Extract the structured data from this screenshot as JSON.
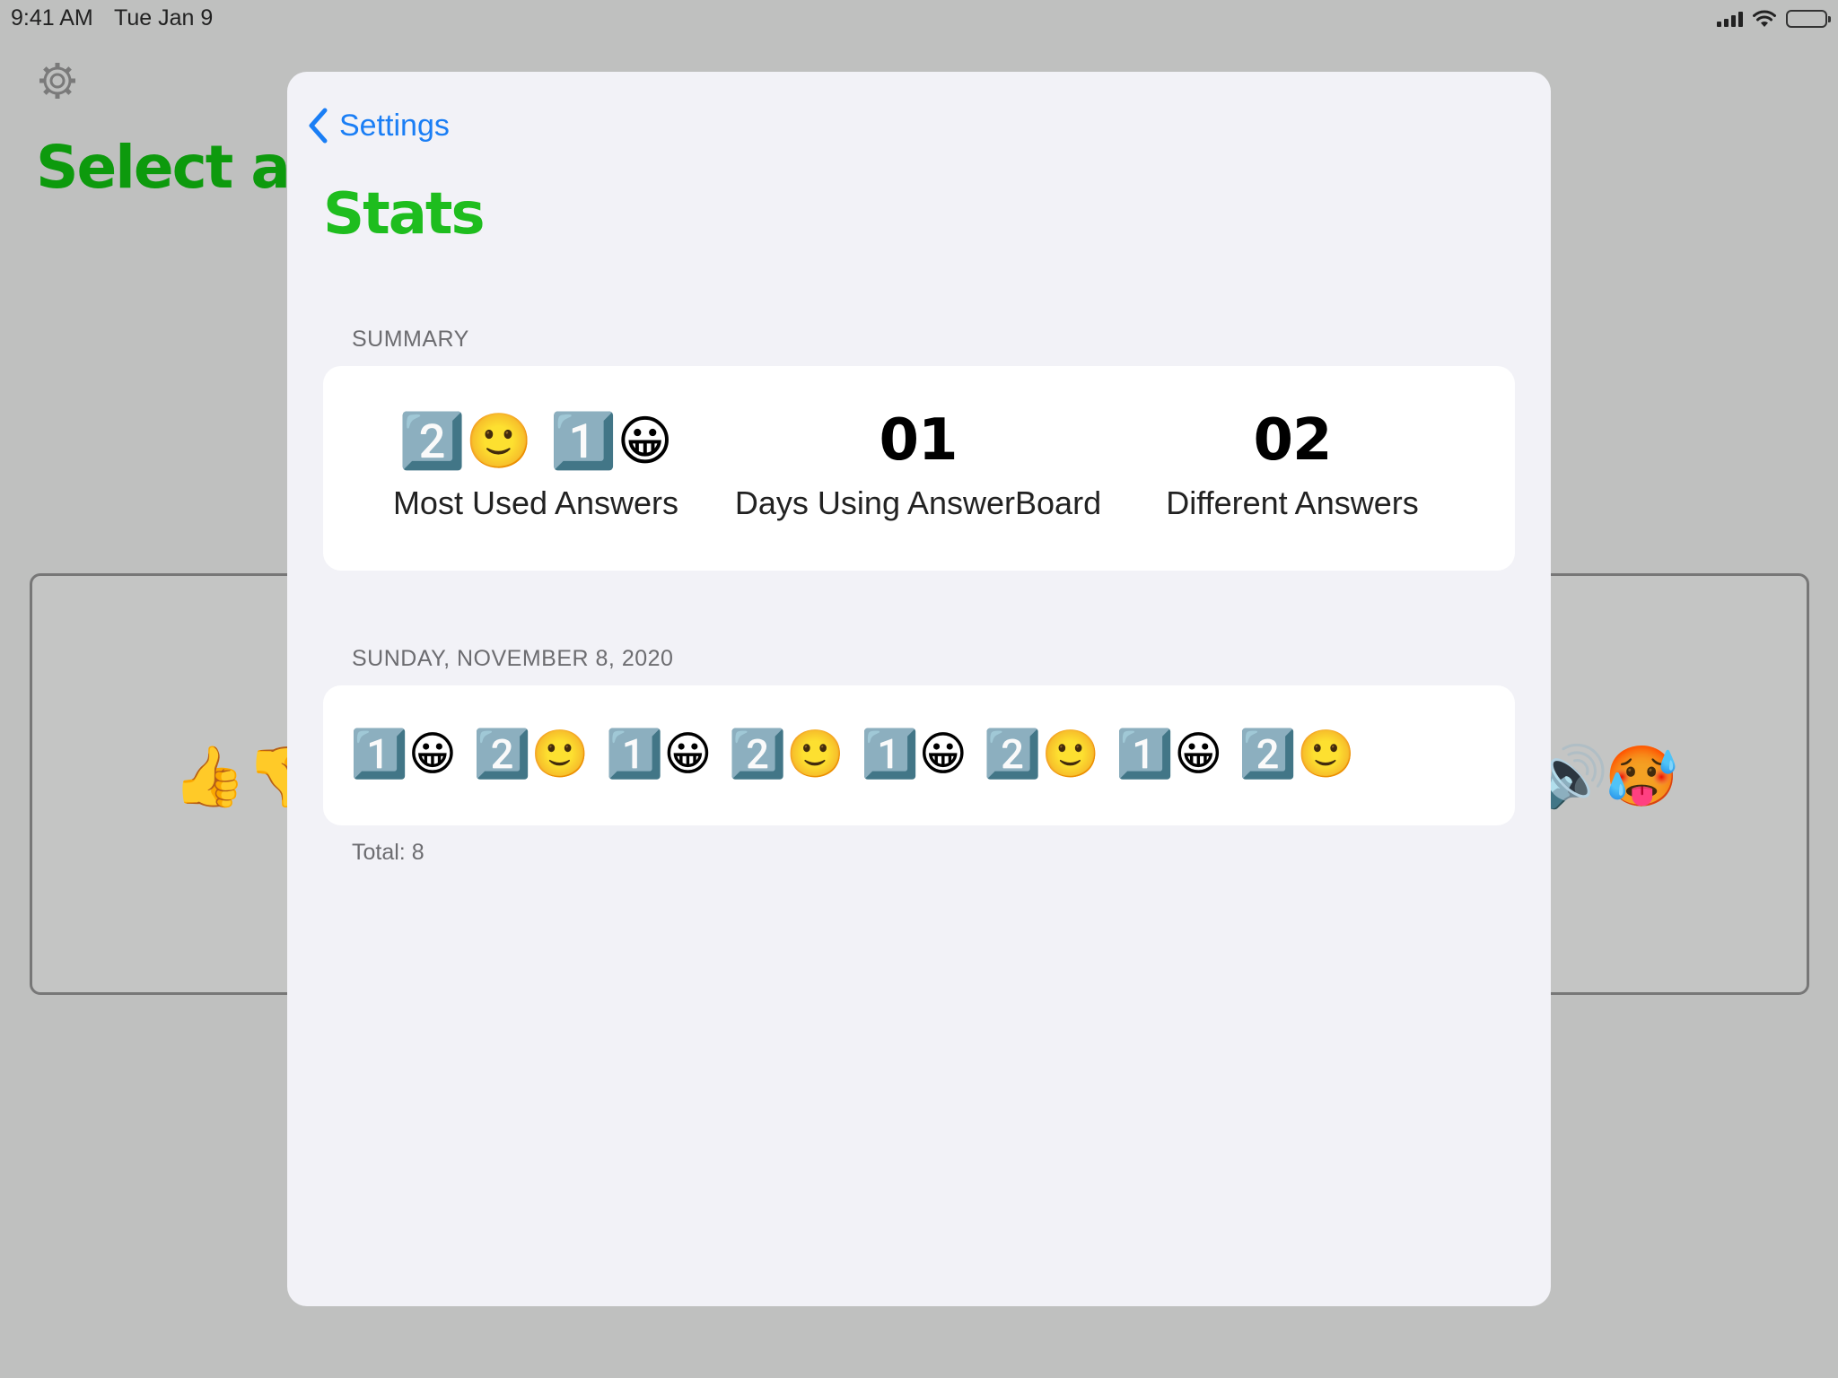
{
  "status_bar": {
    "time": "9:41 AM",
    "date": "Tue Jan 9",
    "icons": [
      "signal-icon",
      "wifi-icon",
      "battery-icon"
    ]
  },
  "background": {
    "title": "Select a Ca",
    "emoji_left": "👍👎",
    "emoji_right_a": "🔊",
    "emoji_right_b": "🥵",
    "icon": "gear-icon"
  },
  "sheet": {
    "back_label": "Settings",
    "title": "Stats",
    "summary": {
      "header": "SUMMARY",
      "items": [
        {
          "value": "2️⃣🙂 1️⃣😀",
          "label": "Most Used Answers"
        },
        {
          "value": "01",
          "label": "Days Using AnswerBoard"
        },
        {
          "value": "02",
          "label": "Different Answers"
        }
      ]
    },
    "day": {
      "header": "SUNDAY, NOVEMBER 8, 2020",
      "answers": [
        "1️⃣😀",
        "2️⃣🙂",
        "1️⃣😀",
        "2️⃣🙂",
        "1️⃣😀",
        "2️⃣🙂",
        "1️⃣😀",
        "2️⃣🙂"
      ],
      "total": "Total: 8"
    }
  },
  "colors": {
    "accent_green": "#1ebd1e",
    "link_blue": "#1a7ef5",
    "backdrop": "#bfc0bf",
    "sheet_bg": "#f2f2f7"
  }
}
